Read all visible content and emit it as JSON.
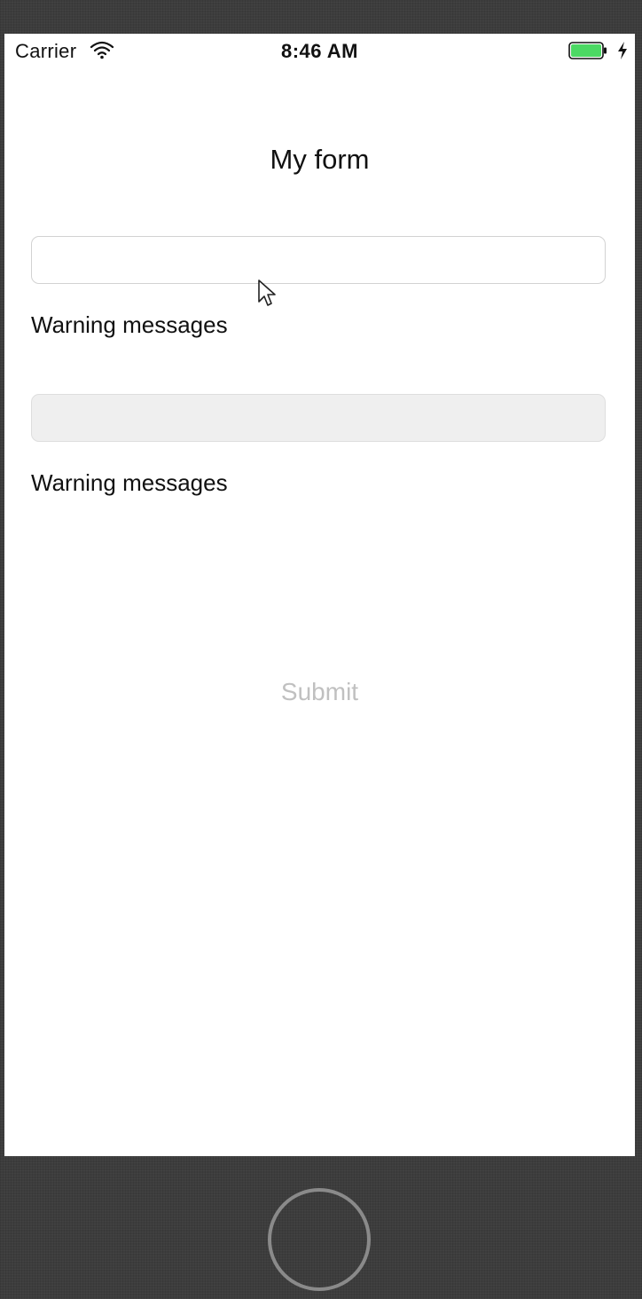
{
  "status_bar": {
    "carrier": "Carrier",
    "time": "8:46 AM",
    "wifi_icon": "wifi-icon",
    "battery_icon": "battery-icon",
    "battery_level": 1.0,
    "charging_icon": "charging-bolt-icon"
  },
  "form": {
    "title": "My form",
    "fields": [
      {
        "value": "",
        "placeholder": ""
      },
      {
        "value": "",
        "placeholder": ""
      }
    ],
    "warnings": [
      "Warning messages",
      "Warning messages"
    ],
    "submit_label": "Submit"
  },
  "colors": {
    "battery": "#4cd964",
    "submit_disabled": "#c0c0c0",
    "device_frame": "#3d3d3d"
  },
  "home_button_icon": "home-button-circle"
}
